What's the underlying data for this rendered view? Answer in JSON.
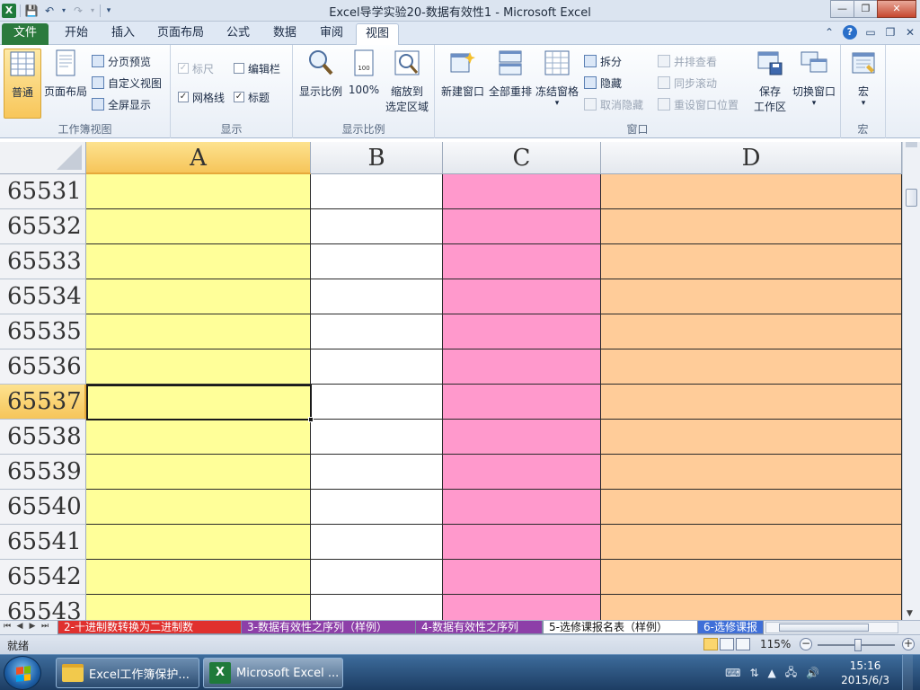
{
  "window": {
    "title": "Excel导学实验20-数据有效性1  -  Microsoft Excel",
    "min": "—",
    "max": "❐",
    "close": "✕"
  },
  "tabs": {
    "file": "文件",
    "home": "开始",
    "insert": "插入",
    "page_layout": "页面布局",
    "formulas": "公式",
    "data": "数据",
    "review": "审阅",
    "view": "视图"
  },
  "ribbon": {
    "workbook_views": {
      "label": "工作簿视图",
      "normal": "普通",
      "page_layout": "页面布局",
      "page_break": "分页预览",
      "custom_views": "自定义视图",
      "full_screen": "全屏显示"
    },
    "show": {
      "label": "显示",
      "ruler": "标尺",
      "formula_bar": "编辑栏",
      "gridlines": "网格线",
      "headings": "标题",
      "ruler_checked": true,
      "formula_bar_checked": false,
      "gridlines_checked": true,
      "headings_checked": true
    },
    "zoom": {
      "label": "显示比例",
      "zoom": "显示比例",
      "zoom100": "100%",
      "zoom_to_selection_1": "缩放到",
      "zoom_to_selection_2": "选定区域"
    },
    "window": {
      "label": "窗口",
      "new_window": "新建窗口",
      "arrange_all": "全部重排",
      "freeze_panes": "冻结窗格",
      "split": "拆分",
      "hide": "隐藏",
      "unhide": "取消隐藏",
      "side_by_side": "并排查看",
      "sync_scroll": "同步滚动",
      "reset_position": "重设窗口位置",
      "save_workspace_1": "保存",
      "save_workspace_2": "工作区",
      "switch_windows": "切换窗口"
    },
    "macros": {
      "label": "宏",
      "macros": "宏"
    }
  },
  "grid": {
    "columns": [
      "A",
      "B",
      "C",
      "D"
    ],
    "rows": [
      "65531",
      "65532",
      "65533",
      "65534",
      "65535",
      "65536",
      "65537",
      "65538",
      "65539",
      "65540",
      "65541",
      "65542",
      "65543"
    ],
    "selected_row": "65537",
    "selected_column": "A",
    "column_colors": {
      "A": "#ffff99",
      "B": "#ffffff",
      "C": "#ff99cc",
      "D": "#ffcc99"
    }
  },
  "sheets": [
    {
      "label": "2-十进制数转换为二进制数",
      "color": "red"
    },
    {
      "label": "3-数据有效性之序列（样例）",
      "color": "purple"
    },
    {
      "label": "4-数据有效性之序列",
      "color": "purple"
    },
    {
      "label": "5-选修课报名表（样例）",
      "color": "white",
      "active": true
    },
    {
      "label": "6-选修课报",
      "color": "blue"
    }
  ],
  "status": {
    "ready": "就绪",
    "zoom": "115%",
    "zoom_minus": "−",
    "zoom_plus": "+"
  },
  "taskbar": {
    "items": [
      {
        "label": "Excel工作簿保护..."
      },
      {
        "label": "Microsoft Excel ..."
      }
    ],
    "time": "15:16",
    "date": "2015/6/3"
  }
}
